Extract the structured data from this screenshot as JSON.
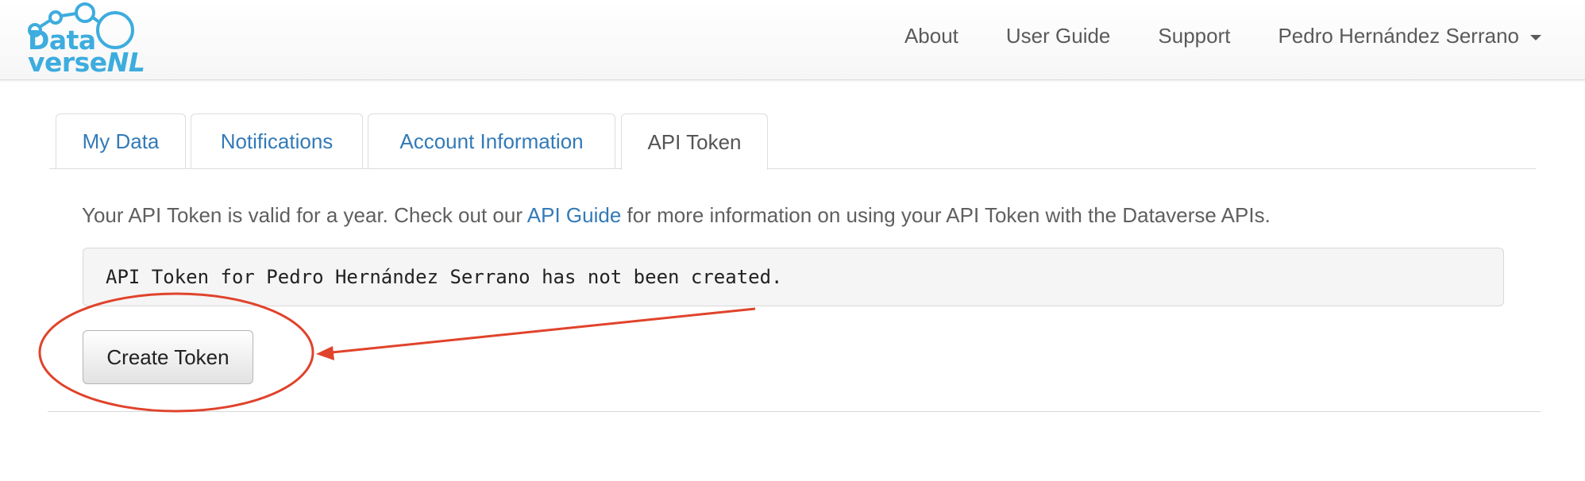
{
  "brand": {
    "line1": "Data",
    "line2_a": "verse",
    "line2_b": "NL",
    "color": "#3dacde"
  },
  "nav": {
    "about": "About",
    "user_guide": "User Guide",
    "support": "Support",
    "user": "Pedro Hernández Serrano"
  },
  "tabs": [
    {
      "label": "My Data",
      "active": false
    },
    {
      "label": "Notifications",
      "active": false
    },
    {
      "label": "Account Information",
      "active": false
    },
    {
      "label": "API Token",
      "active": true
    }
  ],
  "intro": {
    "before": "Your API Token is valid for a year. Check out our ",
    "link": "API Guide",
    "after": " for more information on using your API Token with the Dataverse APIs."
  },
  "token_message": "API Token for Pedro Hernández Serrano has not been created.",
  "create_button": "Create Token",
  "colors": {
    "link": "#337ab7",
    "annotation": "#e0432b"
  }
}
